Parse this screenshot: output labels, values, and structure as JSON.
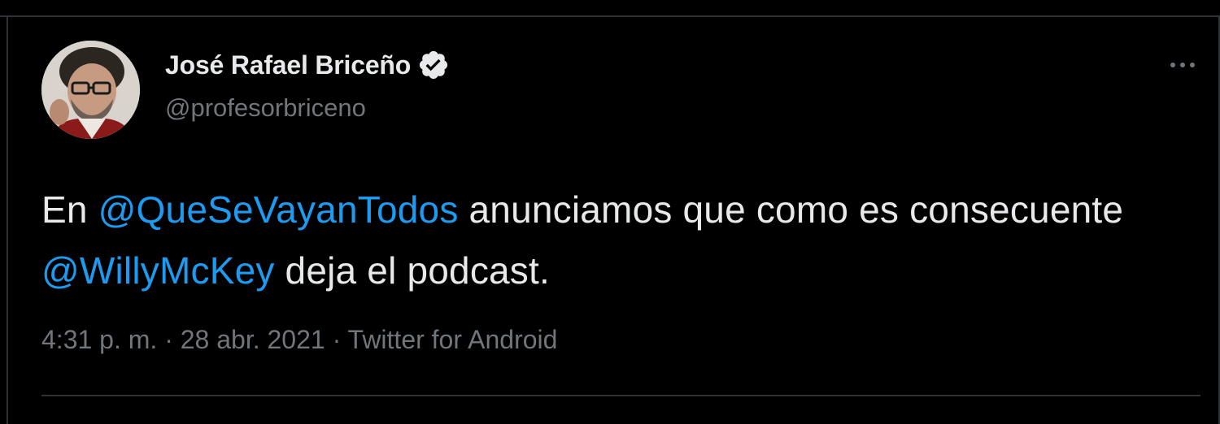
{
  "author": {
    "display_name": "José Rafael Briceño",
    "handle": "@profesorbriceno",
    "verified": true,
    "avatar_icon": "profile-photo"
  },
  "tweet": {
    "segments": [
      {
        "text": "En ",
        "type": "text"
      },
      {
        "text": "@QueSeVayanTodos",
        "type": "mention"
      },
      {
        "text": " anunciamos que como es consecuente ",
        "type": "text"
      },
      {
        "text": "@WillyMcKey",
        "type": "mention"
      },
      {
        "text": " deja el podcast.",
        "type": "text"
      }
    ]
  },
  "meta": {
    "time": "4:31 p. m.",
    "separator": "·",
    "date": "28 abr. 2021",
    "source": "Twitter for Android"
  },
  "menu": {
    "icon": "more-horizontal-icon"
  },
  "colors": {
    "background": "#000000",
    "text": "#e7e9ea",
    "secondary": "#71767b",
    "accent": "#1d9bf0",
    "border": "#2f3336"
  }
}
